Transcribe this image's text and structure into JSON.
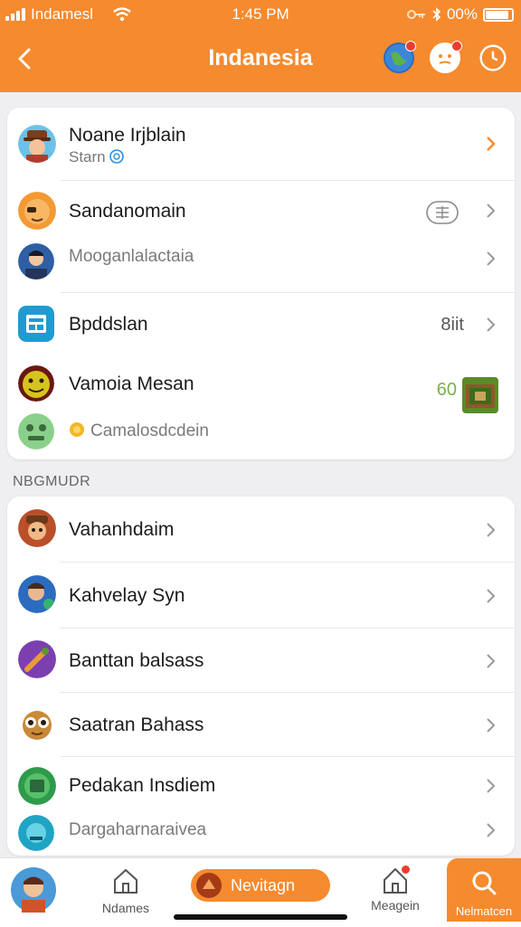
{
  "status_bar": {
    "carrier": "Indamesl",
    "time": "1:45 PM",
    "battery": "00%"
  },
  "header": {
    "title": "Indanesia"
  },
  "top_list": {
    "rows": [
      {
        "label": "Noane Irjblain",
        "sub": "Starn",
        "value": ""
      },
      {
        "label": "Sandanomain",
        "sub": "",
        "value": ""
      },
      {
        "label": "Mooganlalactaia",
        "sub": "",
        "value": ""
      },
      {
        "label": "Bpddslan",
        "sub": "",
        "value": "8iit"
      },
      {
        "label": "Vamoia Mesan",
        "sub": "",
        "value": "60"
      },
      {
        "label": "",
        "sub": "Camalosdcdein",
        "value": ""
      }
    ]
  },
  "section": {
    "title": "NBGMUDR"
  },
  "bottom_list": {
    "rows": [
      {
        "label": "Vahanhdaim"
      },
      {
        "label": "Kahvelay Syn"
      },
      {
        "label": "Banttan balsass"
      },
      {
        "label": "Saatran Bahass"
      },
      {
        "label": "Pedakan Insdiem"
      },
      {
        "label": "Dargaharnaraivea"
      }
    ]
  },
  "tab_bar": {
    "items": [
      {
        "label": "Ndames"
      },
      {
        "label": "Nevitagn"
      },
      {
        "label": "Meagein"
      },
      {
        "label": "Nelmatcen"
      }
    ]
  },
  "colors": {
    "accent": "#f68a2e",
    "green": "#3fa84b",
    "notification": "#ea3d2f"
  }
}
